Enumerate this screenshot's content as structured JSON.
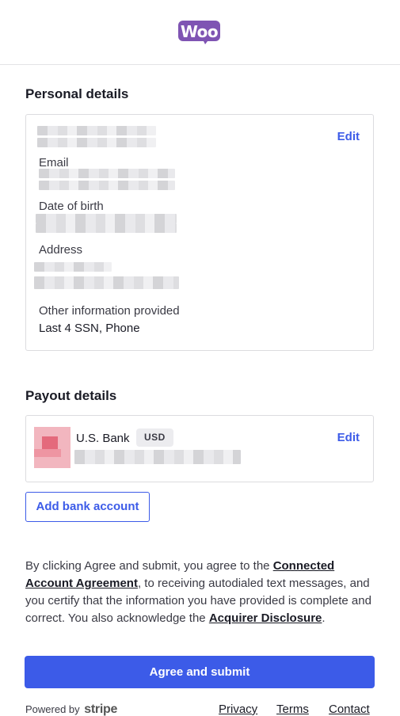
{
  "header": {
    "logo_text": "Woo",
    "logo_color": "#7f54b3"
  },
  "personal": {
    "title": "Personal details",
    "edit_label": "Edit",
    "email_label": "Email",
    "dob_label": "Date of birth",
    "address_label": "Address",
    "other_label": "Other information provided",
    "other_value": "Last 4 SSN, Phone"
  },
  "payout": {
    "title": "Payout details",
    "bank_name": "U.S. Bank",
    "currency_badge": "USD",
    "edit_label": "Edit",
    "add_bank_label": "Add bank account"
  },
  "legal": {
    "part1": "By clicking Agree and submit, you agree to the ",
    "link1": "Connected Account Agreement",
    "part2": ", to receiving autodialed text messages, and you certify that the information you have provided is complete and correct. You also acknowledge the ",
    "link2": "Acquirer Disclosure",
    "part3": "."
  },
  "submit_label": "Agree and submit",
  "footer": {
    "powered_by": "Powered by",
    "brand": "stripe",
    "privacy": "Privacy",
    "terms": "Terms",
    "contact": "Contact"
  },
  "colors": {
    "accent": "#3c5be8",
    "text": "#1a1b25"
  },
  "icons": [
    "woo-logo-icon",
    "bank-icon"
  ]
}
